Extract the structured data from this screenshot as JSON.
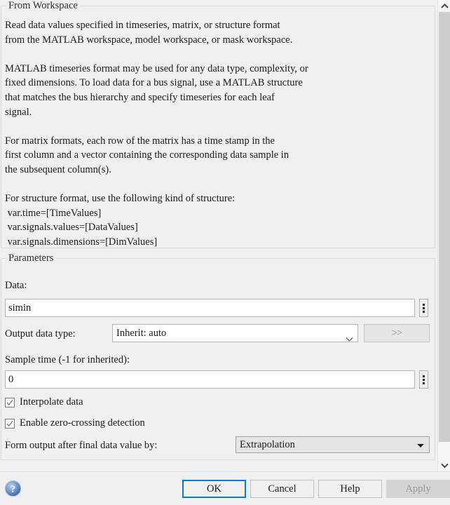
{
  "description_group": {
    "title": "From Workspace",
    "body": "Read data values specified in timeseries, matrix, or structure format\nfrom the MATLAB workspace, model workspace, or mask workspace.\n\nMATLAB timeseries format may be used for any data type, complexity, or\nfixed dimensions. To load data for a bus signal, use a MATLAB structure\nthat matches the bus hierarchy and specify timeseries for each leaf\nsignal.\n\nFor matrix formats, each row of the matrix has a time stamp in the\nfirst column and a vector containing the corresponding data sample in\nthe subsequent column(s).\n\nFor structure format, use the following kind of structure:\n var.time=[TimeValues]\n var.signals.values=[DataValues]\n var.signals.dimensions=[DimValues]"
  },
  "parameters_group": {
    "title": "Parameters",
    "data": {
      "label": "Data:",
      "value": "simin",
      "stepper_icon": "kebab-icon"
    },
    "output_data_type": {
      "label": "Output data type:",
      "value": "Inherit: auto",
      "chevron_icon": "chevron-down-icon",
      "assistant_button_label": ">>"
    },
    "sample_time": {
      "label": "Sample time (-1 for inherited):",
      "value": "0",
      "stepper_icon": "kebab-icon"
    },
    "interpolate_data": {
      "label": "Interpolate data",
      "checked": true
    },
    "zero_crossing": {
      "label": "Enable zero-crossing detection",
      "checked": true
    },
    "form_output": {
      "label": "Form output after final data value by:",
      "value": "Extrapolation",
      "arrow_icon": "triangle-down-icon"
    }
  },
  "bottom_bar": {
    "help_icon": "help-circle-icon",
    "buttons": {
      "ok": "OK",
      "cancel": "Cancel",
      "help": "Help",
      "apply": "Apply"
    }
  },
  "scrollbar": {
    "up_icon": "chevron-up-icon",
    "down_icon": "chevron-down-icon"
  },
  "colors": {
    "focus_blue": "#0a7bd4",
    "help_blue": "#4a78c0",
    "window_bg": "#f0f0f0",
    "scroll_thumb": "#cdcdcd"
  }
}
